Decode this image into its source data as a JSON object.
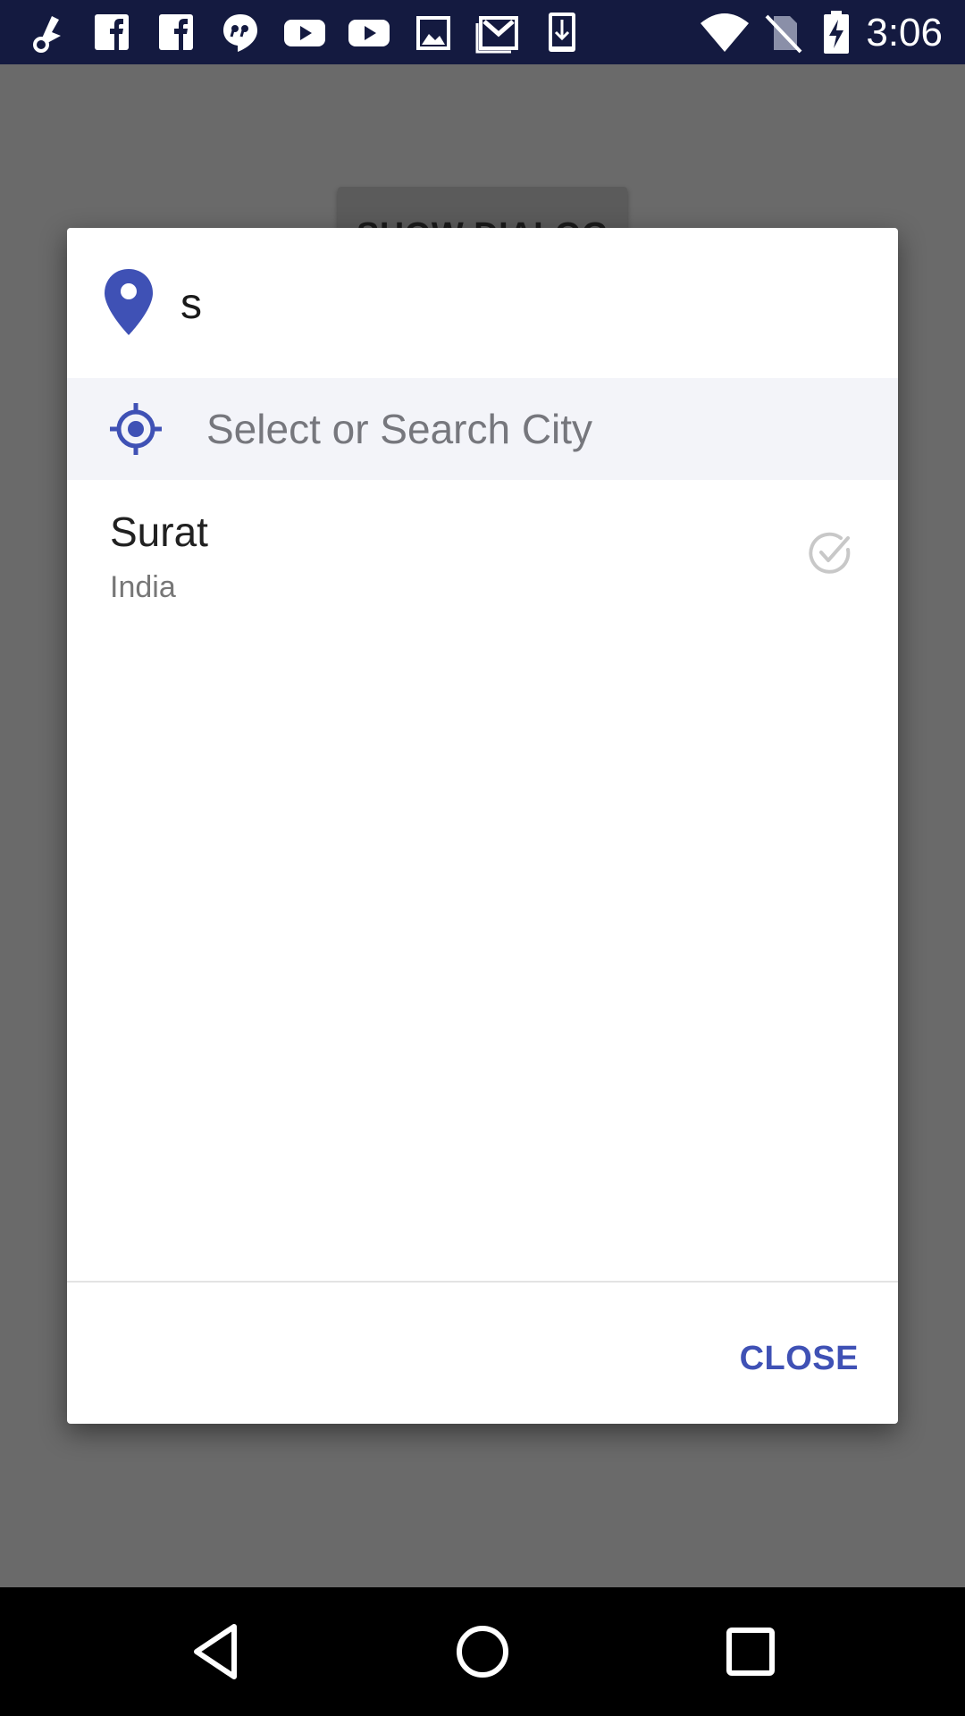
{
  "status_bar": {
    "time": "3:06",
    "icons": [
      "app-notification-icon",
      "facebook-icon",
      "facebook-icon",
      "quote-message-icon",
      "youtube-icon",
      "youtube-icon",
      "gallery-icon",
      "gmail-icon",
      "download-icon",
      "wifi-icon",
      "no-sim-icon",
      "battery-charging-icon"
    ]
  },
  "app": {
    "show_dialog_label": "SHOW DIALOG"
  },
  "dialog": {
    "search": {
      "value": "s",
      "icon": "location-pin-icon"
    },
    "select_city": {
      "label": "Select or Search City",
      "icon": "gps-target-icon"
    },
    "results": [
      {
        "city": "Surat",
        "country": "India",
        "icon": "check-circle-icon"
      }
    ],
    "close_label": "CLOSE"
  },
  "colors": {
    "accent": "#3f51b5",
    "status_bar": "#141a40",
    "scrim": "#6a6a6a",
    "select_row_bg": "#f3f4f9"
  },
  "nav_bar": {
    "buttons": [
      "back-icon",
      "home-icon",
      "recents-icon"
    ]
  }
}
